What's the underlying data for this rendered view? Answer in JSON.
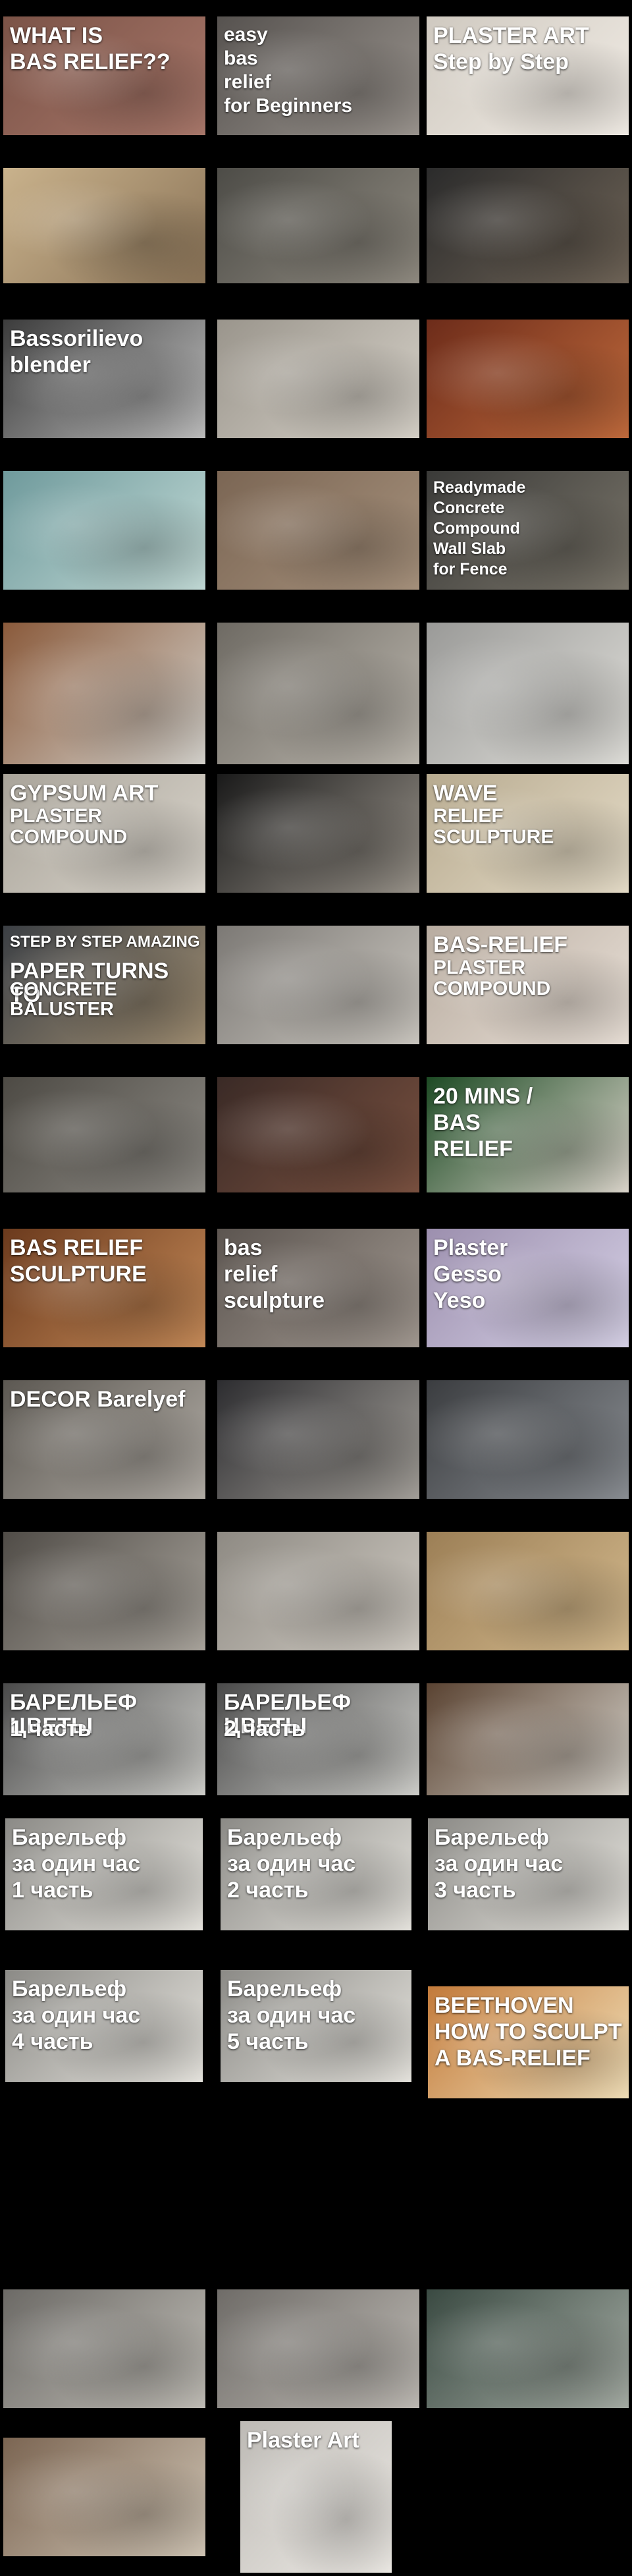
{
  "tiles": [
    {
      "name": "what-is-bas-relief",
      "texts": [
        "WHAT IS",
        "BAS RELIEF??"
      ],
      "colors": [
        "#7b5347",
        "#a8776a"
      ]
    },
    {
      "name": "easy-bas-relief-for-beginners",
      "texts": [
        "easy",
        "bas",
        "relief",
        "for Beginners"
      ],
      "colors": [
        "#56524f",
        "#9a948e"
      ]
    },
    {
      "name": "plaster-art-step-by-step",
      "texts": [
        "PLASTER ART",
        "Step by Step"
      ],
      "colors": [
        "#cfc9c0",
        "#f1ece5"
      ]
    },
    {
      "name": "man-carving-panel",
      "texts": [],
      "colors": [
        "#c9b28c",
        "#8a7357"
      ]
    },
    {
      "name": "clay-flower-relief",
      "texts": [],
      "colors": [
        "#4d4c47",
        "#8f8a80"
      ]
    },
    {
      "name": "hands-shaping-clay",
      "texts": [],
      "colors": [
        "#2b2b2b",
        "#6f6457"
      ]
    },
    {
      "name": "bassorilievo-blender",
      "texts": [
        "Bassorilievo",
        "blender"
      ],
      "colors": [
        "#3c3c3c",
        "#bdbdbd"
      ]
    },
    {
      "name": "battle-relief-carving",
      "texts": [],
      "colors": [
        "#9a958c",
        "#d6d1c8"
      ]
    },
    {
      "name": "terracotta-relief",
      "texts": [],
      "colors": [
        "#6d2c1a",
        "#c06a3c"
      ]
    },
    {
      "name": "museum-gallery-hall",
      "texts": [],
      "colors": [
        "#6f9a9c",
        "#c2dad6"
      ]
    },
    {
      "name": "ancient-stone-frieze",
      "texts": [],
      "colors": [
        "#7b6654",
        "#a6917c"
      ]
    },
    {
      "name": "readymade-concrete-compound-wall",
      "texts": [
        "Readymade",
        "Concrete",
        "Compound",
        "Wall Slab",
        "for Fence"
      ],
      "colors": [
        "#3a3a38",
        "#7a756a"
      ]
    },
    {
      "name": "terracotta-vases-man",
      "texts": [],
      "colors": [
        "#8a5a3b",
        "#d4d2cc"
      ]
    },
    {
      "name": "hand-sculpting-tile",
      "texts": [],
      "colors": [
        "#6e6a63",
        "#bcb7ae"
      ]
    },
    {
      "name": "heron-relief-panel",
      "texts": [],
      "colors": [
        "#9a9a98",
        "#e0dfda"
      ]
    },
    {
      "name": "gypsum-art-plaster",
      "texts": [
        "GYPSUM ART",
        "PLASTER COMPOUND"
      ],
      "colors": [
        "#a9a49a",
        "#dad5cc"
      ]
    },
    {
      "name": "tree-relief-frame",
      "texts": [],
      "colors": [
        "#1a1a1a",
        "#9a948b"
      ]
    },
    {
      "name": "relief-sculpture-wave",
      "texts": [
        "WAVE",
        "RELIEF SCULPTURE"
      ],
      "colors": [
        "#b7aa8f",
        "#e5dcc8"
      ]
    },
    {
      "name": "paper-turns-to-concrete-baluster",
      "texts": [
        "STEP BY STEP AMAZING",
        "PAPER TURNS TO",
        "CONCRETE BALUSTER"
      ],
      "colors": [
        "#3b3f44",
        "#a08e72"
      ]
    },
    {
      "name": "plaster-ornament-carving",
      "texts": [],
      "colors": [
        "#7c7975",
        "#cbc7c0"
      ]
    },
    {
      "name": "bas-relief-plaster-compound",
      "texts": [
        "BAS-RELIEF",
        "PLASTER COMPOUND"
      ],
      "colors": [
        "#b8aca0",
        "#e9e0d7"
      ]
    },
    {
      "name": "man-carving-fish-relief",
      "texts": [],
      "colors": [
        "#4d4a44",
        "#8d8a84"
      ]
    },
    {
      "name": "painted-fish-mural",
      "texts": [],
      "colors": [
        "#3a2a26",
        "#7a5140"
      ]
    },
    {
      "name": "20-mins-bas-relief",
      "texts": [
        "20 MINS /",
        "BAS",
        "RELIEF"
      ],
      "colors": [
        "#1d4a24",
        "#dcd6cc"
      ]
    },
    {
      "name": "bas-relief-sculpture-face",
      "texts": [
        "BAS RELIEF",
        "SCULPTURE"
      ],
      "colors": [
        "#6b3a1d",
        "#c58a58"
      ]
    },
    {
      "name": "bas-relief-sculpture",
      "texts": [
        "bas",
        "relief",
        "sculpture"
      ],
      "colors": [
        "#5c5550",
        "#a29991"
      ]
    },
    {
      "name": "plaster-gesso-yeso",
      "texts": [
        "Plaster",
        "Gesso",
        "Yeso"
      ],
      "colors": [
        "#9c8fae",
        "#d6d1e6"
      ]
    },
    {
      "name": "man-painting-relief",
      "texts": [
        "DECOR Barelyef"
      ],
      "colors": [
        "#5c5852",
        "#b2ada6"
      ]
    },
    {
      "name": "man-installing-panel",
      "texts": [],
      "colors": [
        "#2d2d30",
        "#a4a09a"
      ]
    },
    {
      "name": "lizard-wall-relief",
      "texts": [],
      "colors": [
        "#3b3d40",
        "#8a8e93"
      ]
    },
    {
      "name": "vine-molding",
      "texts": [],
      "colors": [
        "#504c47",
        "#a9a49c"
      ]
    },
    {
      "name": "elephant-relief",
      "texts": [],
      "colors": [
        "#8e8a83",
        "#cfcac2"
      ]
    },
    {
      "name": "figure-relief-sandstone",
      "texts": [],
      "colors": [
        "#9c7f56",
        "#d3b98d"
      ]
    },
    {
      "name": "barelyef-cvety-part-1",
      "texts": [
        "БАРЕЛЬЕФ ЦВЕТЫ",
        "1 часть"
      ],
      "colors": [
        "#4a4a4a",
        "#cfcfcb"
      ]
    },
    {
      "name": "barelyef-cvety-part-2",
      "texts": [
        "БАРЕЛЬЕФ ЦВЕТЫ",
        "2 часть"
      ],
      "colors": [
        "#4a4a4a",
        "#cfcfcb"
      ]
    },
    {
      "name": "calla-lily-relief",
      "texts": [],
      "colors": [
        "#5a4332",
        "#d4d0c8"
      ]
    },
    {
      "name": "barelyef-za-odin-chas-1",
      "texts": [
        "Барельеф",
        "за один час",
        "1 часть"
      ],
      "colors": [
        "#8b8a86",
        "#e6e4de"
      ]
    },
    {
      "name": "barelyef-za-odin-chas-2",
      "texts": [
        "Барельеф",
        "за один час",
        "2 часть"
      ],
      "colors": [
        "#8b8a86",
        "#e6e4de"
      ]
    },
    {
      "name": "barelyef-za-odin-chas-3",
      "texts": [
        "Барельеф",
        "за один час",
        "3 часть"
      ],
      "colors": [
        "#8b8a86",
        "#e6e4de"
      ]
    },
    {
      "name": "barelyef-za-odin-chas-4",
      "texts": [
        "Барельеф",
        "за один час",
        "4 часть"
      ],
      "colors": [
        "#8b8a86",
        "#e6e4de"
      ]
    },
    {
      "name": "barelyef-za-odin-chas-5",
      "texts": [
        "Барельеф",
        "за один час",
        "5 часть"
      ],
      "colors": [
        "#8b8a86",
        "#e6e4de"
      ]
    },
    {
      "name": "beethoven-how-to-sculpt",
      "texts": [
        "BEETHOVEN",
        "HOW TO SCULPT",
        "A BAS-RELIEF"
      ],
      "colors": [
        "#c27a3a",
        "#f1dfb8"
      ]
    },
    {
      "name": "fish-relief-hand",
      "texts": [],
      "colors": [
        "#6c6a66",
        "#c0bdb6"
      ]
    },
    {
      "name": "lion-head-relief",
      "texts": [],
      "colors": [
        "#6f6c68",
        "#bebab4"
      ]
    },
    {
      "name": "man-sculpting-wall",
      "texts": [],
      "colors": [
        "#3a4a42",
        "#a5aca4"
      ]
    },
    {
      "name": "hands-carving-bowl",
      "texts": [],
      "colors": [
        "#7b6552",
        "#d0c5b5"
      ]
    },
    {
      "name": "plaster-art-horse",
      "texts": [
        "Plaster Art"
      ],
      "colors": [
        "#bdbab5",
        "#ece9e4"
      ]
    },
    {
      "name": "tree-relief-wall",
      "texts": [],
      "colors": [
        "#5e5a55",
        "#c2beb8"
      ]
    },
    {
      "name": "hands-carving-ornament",
      "texts": [],
      "colors": [
        "#5f5a52",
        "#c9c2b6"
      ]
    },
    {
      "name": "ornamental-frame-relief",
      "texts": [],
      "colors": [
        "#a79a86",
        "#e4ddd0"
      ]
    }
  ]
}
